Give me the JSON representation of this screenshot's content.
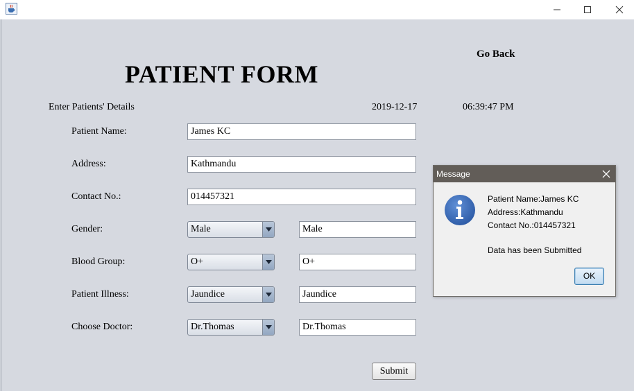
{
  "window": {
    "icon": "java-coffee-cup-icon",
    "controls": [
      "minimize-icon",
      "maximize-icon",
      "close-icon"
    ]
  },
  "header": {
    "go_back": "Go Back",
    "title": "PATIENT FORM",
    "subtitle": "Enter Patients' Details",
    "date": "2019-12-17",
    "time": "06:39:47 PM"
  },
  "form": {
    "name": {
      "label": "Patient Name:",
      "value": "James KC"
    },
    "address": {
      "label": "Address:",
      "value": "Kathmandu"
    },
    "contact": {
      "label": "Contact No.:",
      "value": "014457321"
    },
    "gender": {
      "label": "Gender:",
      "selected": "Male",
      "field": "Male"
    },
    "blood_group": {
      "label": "Blood Group:",
      "selected": "O+",
      "field": "O+"
    },
    "illness": {
      "label": "Patient Illness:",
      "selected": "Jaundice",
      "field": "Jaundice"
    },
    "doctor": {
      "label": "Choose Doctor:",
      "selected": "Dr.Thomas",
      "field": "Dr.Thomas"
    },
    "submit_label": "Submit"
  },
  "dialog": {
    "title": "Message",
    "icon": "info-icon",
    "lines": [
      "Patient Name:James KC",
      "Address:Kathmandu",
      "Contact No.:014457321",
      "Data has been Submitted"
    ],
    "ok_label": "OK"
  },
  "colors": {
    "background": "#d6d9e0",
    "dialog_titlebar": "#625d58",
    "info_icon": "#2f5da8"
  }
}
